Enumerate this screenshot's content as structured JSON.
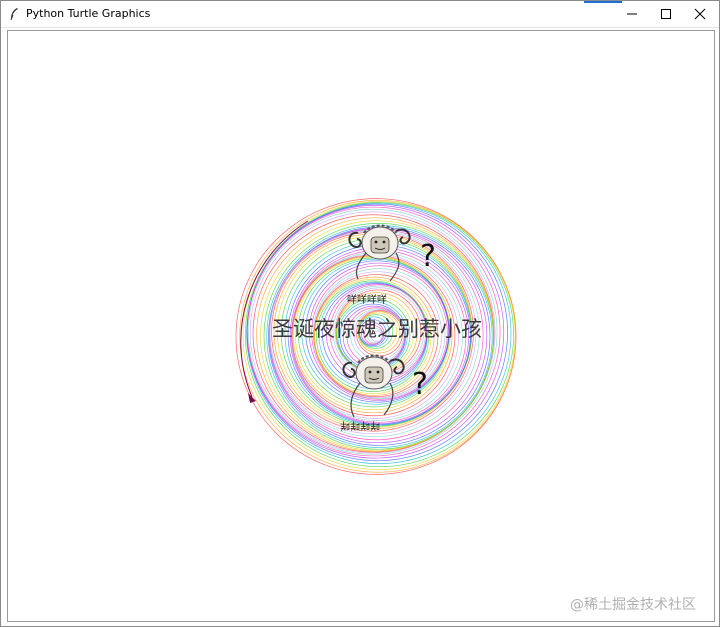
{
  "window": {
    "title": "Python Turtle Graphics",
    "controls": {
      "minimize": "minimize-icon",
      "maximize": "maximize-icon",
      "close": "close-icon"
    }
  },
  "canvas": {
    "title_text": "圣诞夜惊魂之别惹小孩",
    "sheep_caption_top": "咩咩咩咩",
    "sheep_caption_bottom": "咩咩咩咩",
    "question_mark": "?",
    "watermark": "@稀土掘金技术社区",
    "turtle_color": "#7a0a4a"
  }
}
